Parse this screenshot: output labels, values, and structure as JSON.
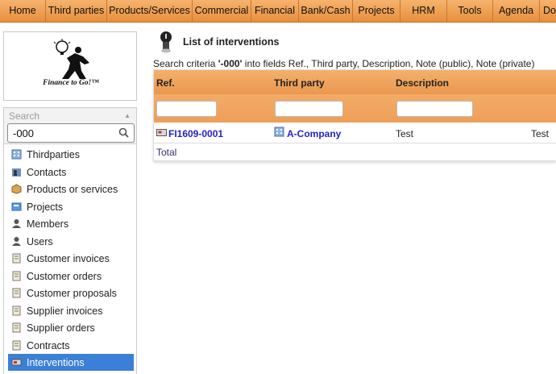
{
  "topmenu": [
    "Home",
    "Third parties",
    "Products/Services",
    "Commercial",
    "Financial",
    "Bank/Cash",
    "Projects",
    "HRM",
    "Tools",
    "Agenda",
    "Do"
  ],
  "logo": {
    "tagline": "Finance to Go!™"
  },
  "search": {
    "header": "Search",
    "value": "-000"
  },
  "leftmenu": [
    {
      "label": "Thirdparties",
      "icon": "company-icon"
    },
    {
      "label": "Contacts",
      "icon": "contact-icon"
    },
    {
      "label": "Products or services",
      "icon": "box-icon"
    },
    {
      "label": "Projects",
      "icon": "project-icon"
    },
    {
      "label": "Members",
      "icon": "user-icon"
    },
    {
      "label": "Users",
      "icon": "user-icon"
    },
    {
      "label": "Customer invoices",
      "icon": "bill-icon"
    },
    {
      "label": "Customer orders",
      "icon": "order-icon"
    },
    {
      "label": "Customer proposals",
      "icon": "proposal-icon"
    },
    {
      "label": "Supplier invoices",
      "icon": "bill-icon"
    },
    {
      "label": "Supplier orders",
      "icon": "order-icon"
    },
    {
      "label": "Contracts",
      "icon": "contract-icon"
    },
    {
      "label": "Interventions",
      "icon": "intervention-icon",
      "active": true
    }
  ],
  "page": {
    "title": "List of interventions",
    "criteria_prefix": "Search criteria ",
    "criteria_value": "'-000'",
    "criteria_suffix": " into fields Ref., Third party, Description, Note (public), Note (private)"
  },
  "table": {
    "headers": {
      "ref": "Ref.",
      "thirdparty": "Third party",
      "description": "Description"
    },
    "rows": [
      {
        "ref": "FI1609-0001",
        "thirdparty": "A-Company",
        "description": "Test",
        "extra": "Test"
      }
    ],
    "total_label": "Total"
  },
  "colors": {
    "menu": "#f1a25d",
    "active": "#3c7fd6",
    "link": "#2323c4"
  }
}
